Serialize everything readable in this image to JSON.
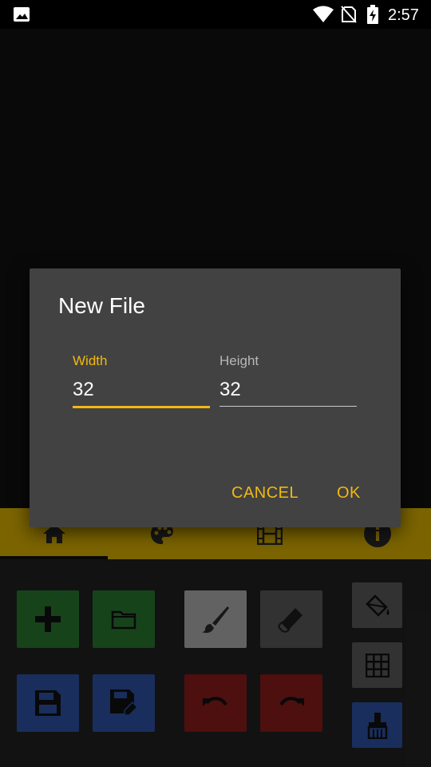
{
  "status_bar": {
    "time": "2:57",
    "icons": [
      "image-icon",
      "wifi-icon",
      "no-sim-icon",
      "battery-charging-icon"
    ]
  },
  "tabs": [
    {
      "icon": "home-icon",
      "selected": true
    },
    {
      "icon": "palette-icon",
      "selected": false
    },
    {
      "icon": "film-icon",
      "selected": false
    },
    {
      "icon": "info-icon",
      "selected": false
    }
  ],
  "dialog": {
    "title": "New File",
    "width_label": "Width",
    "width_value": "32",
    "height_label": "Height",
    "height_value": "32",
    "cancel_label": "CANCEL",
    "ok_label": "OK"
  },
  "toolbar": {
    "buttons": [
      {
        "icon": "add-icon",
        "color": "#2a7b32"
      },
      {
        "icon": "folder-icon",
        "color": "#2a7b32"
      },
      {
        "icon": "brush-icon",
        "color": "#b2b2b2"
      },
      {
        "icon": "eraser-icon",
        "color": "#5c5c5c"
      },
      {
        "icon": "fill-bucket-icon",
        "color": "#5c5c5c"
      },
      {
        "icon": "grid-icon",
        "color": "#5c5c5c"
      },
      {
        "icon": "save-icon",
        "color": "#2e55a8"
      },
      {
        "icon": "save-as-icon",
        "color": "#2e55a8"
      },
      {
        "icon": "undo-icon",
        "color": "#8e1c1c"
      },
      {
        "icon": "redo-icon",
        "color": "#8e1c1c"
      },
      {
        "icon": "paint-brush-icon",
        "color": "#2e55a8"
      }
    ]
  },
  "colors": {
    "accent": "#f2b90f",
    "tab_bar": "#e0b600",
    "dialog_bg": "#424242"
  }
}
